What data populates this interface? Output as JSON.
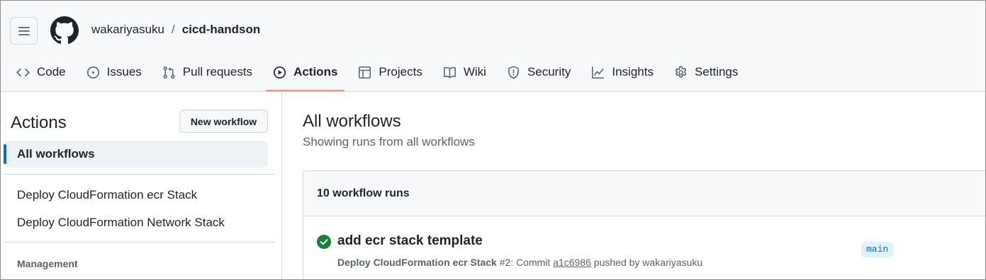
{
  "header": {
    "owner": "wakariyasuku",
    "separator": "/",
    "repo": "cicd-handson"
  },
  "tabs": [
    {
      "label": "Code",
      "icon": "code-icon"
    },
    {
      "label": "Issues",
      "icon": "issue-opened-icon"
    },
    {
      "label": "Pull requests",
      "icon": "git-pull-request-icon"
    },
    {
      "label": "Actions",
      "icon": "play-icon",
      "active": true
    },
    {
      "label": "Projects",
      "icon": "table-icon"
    },
    {
      "label": "Wiki",
      "icon": "book-icon"
    },
    {
      "label": "Security",
      "icon": "shield-icon"
    },
    {
      "label": "Insights",
      "icon": "graph-icon"
    },
    {
      "label": "Settings",
      "icon": "gear-icon"
    }
  ],
  "sidebar": {
    "title": "Actions",
    "new_workflow": "New workflow",
    "all_workflows": "All workflows",
    "workflows": [
      "Deploy CloudFormation ecr Stack",
      "Deploy CloudFormation Network Stack"
    ],
    "management_heading": "Management"
  },
  "main": {
    "title": "All workflows",
    "subtitle": "Showing runs from all workflows",
    "runs_count": "10 workflow runs",
    "runs": [
      {
        "title": "add ecr stack template",
        "workflow": "Deploy CloudFormation ecr Stack",
        "run_number": "#2: Commit",
        "commit": "a1c6986",
        "pushed_by": "pushed by wakariyasuku",
        "branch": "main",
        "status": "success"
      }
    ]
  },
  "colors": {
    "accent_underline": "#fd8c73",
    "success": "#1a7f37",
    "link_blue": "#0969da",
    "branch_bg": "#ddf4ff"
  }
}
